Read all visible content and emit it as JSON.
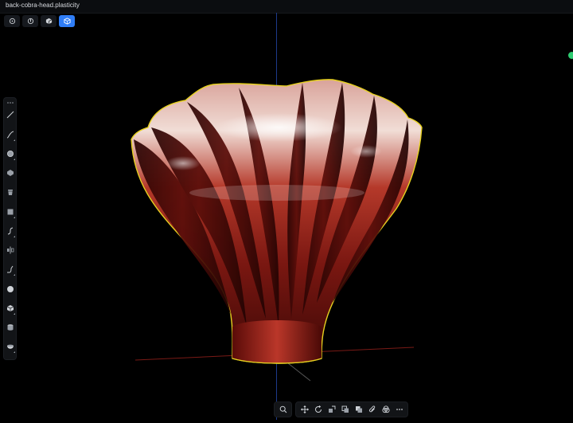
{
  "window": {
    "title": "back-cobra-head.plasticity"
  },
  "view_modes": [
    {
      "name": "vertex-mode",
      "active": false
    },
    {
      "name": "edge-mode",
      "active": false
    },
    {
      "name": "face-mode",
      "active": false
    },
    {
      "name": "solid-mode",
      "active": true
    }
  ],
  "left_tools": [
    "grip-icon",
    "line-icon",
    "curve-icon",
    "circle-icon",
    "polygon-icon",
    "cylinder-icon",
    "box-icon",
    "spline-icon",
    "mirror-icon",
    "fillet-icon",
    "sphere-icon",
    "cube-icon",
    "extrude-icon",
    "shell-icon"
  ],
  "bottom_tools": [
    "search-icon",
    "move-icon",
    "rotate-icon",
    "scale-icon",
    "duplicate-icon",
    "boolean-icon",
    "attach-icon",
    "intersect-icon",
    "more-icon"
  ],
  "colors": {
    "accent": "#2f7df6",
    "selection_outline": "#e6d020",
    "model_base": "#8a1a14",
    "status": "#2ecc71"
  }
}
